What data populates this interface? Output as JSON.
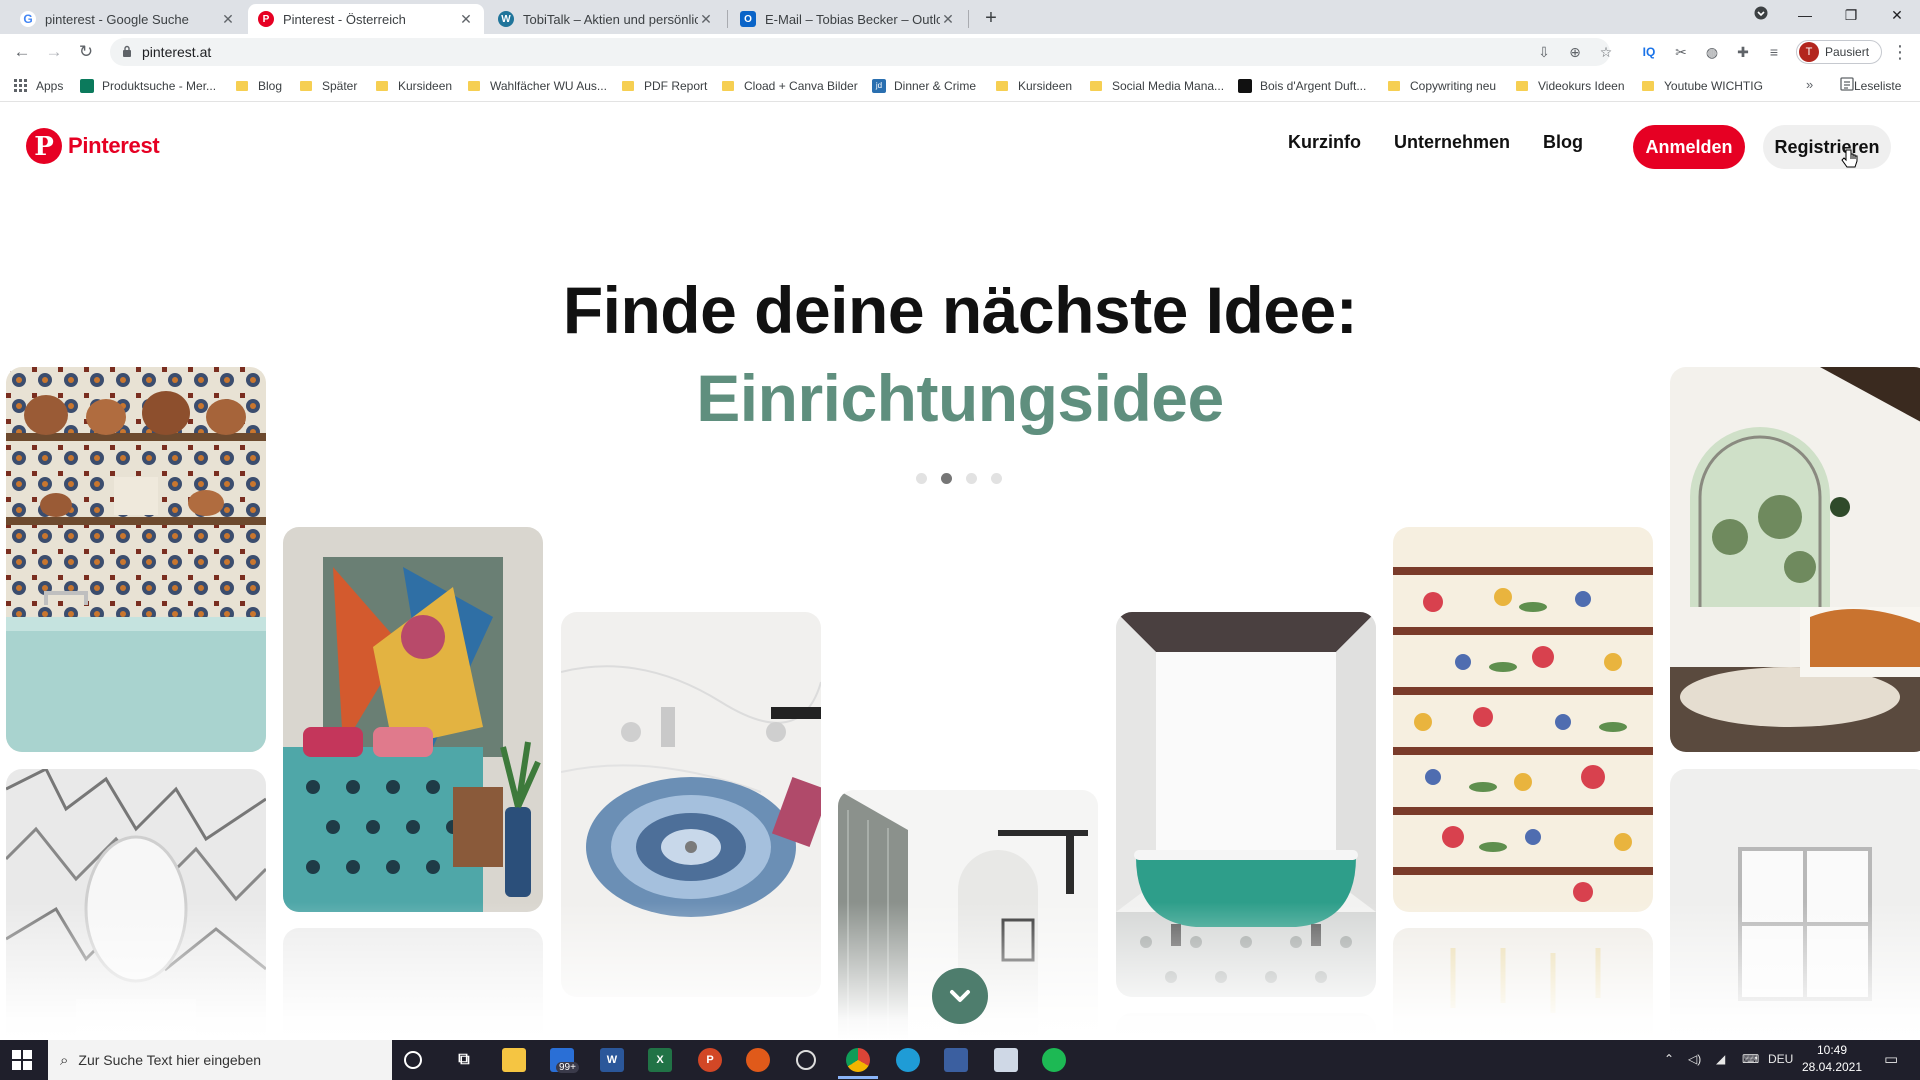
{
  "browser": {
    "tabs": [
      {
        "label": "pinterest - Google Suche",
        "icon": "google-favicon"
      },
      {
        "label": "Pinterest - Österreich",
        "icon": "pinterest-favicon",
        "active": true
      },
      {
        "label": "TobiTalk – Aktien und persönliche",
        "icon": "wordpress-favicon"
      },
      {
        "label": "E-Mail – Tobias Becker – Outlook",
        "icon": "outlook-favicon"
      }
    ],
    "url": "pinterest.at",
    "profile_initial": "T",
    "profile_status": "Pausiert",
    "bookmarks": [
      {
        "label": "Apps",
        "icon": "apps-grid-icon"
      },
      {
        "label": "Produktsuche - Mer...",
        "icon": "produktsuche-icon"
      },
      {
        "label": "Blog",
        "icon": "folder-icon"
      },
      {
        "label": "Später",
        "icon": "folder-icon"
      },
      {
        "label": "Kursideen",
        "icon": "folder-icon"
      },
      {
        "label": "Wahlfächer WU Aus...",
        "icon": "folder-icon"
      },
      {
        "label": "PDF Report",
        "icon": "folder-icon"
      },
      {
        "label": "Cload + Canva Bilder",
        "icon": "folder-icon"
      },
      {
        "label": "Dinner & Crime",
        "icon": "jd-icon"
      },
      {
        "label": "Kursideen",
        "icon": "folder-icon"
      },
      {
        "label": "Social Media Mana...",
        "icon": "folder-icon"
      },
      {
        "label": "Bois d'Argent Duft...",
        "icon": "bois-icon"
      },
      {
        "label": "Copywriting neu",
        "icon": "folder-icon"
      },
      {
        "label": "Videokurs Ideen",
        "icon": "folder-icon"
      },
      {
        "label": "Youtube WICHTIG",
        "icon": "folder-icon"
      }
    ],
    "bookmarks_more": "»",
    "reading_list": "Leseliste"
  },
  "site": {
    "logo_text": "Pinterest",
    "logo_letter": "P",
    "nav": [
      "Kurzinfo",
      "Unternehmen",
      "Blog"
    ],
    "login_label": "Anmelden",
    "signup_label": "Registrieren",
    "headline": "Finde deine nächste Idee:",
    "subheadline": "Einrichtungsidee",
    "carousel_active_index": 2,
    "carousel_count": 4,
    "colors": {
      "brand": "#e60023",
      "accent": "#5f8f7e",
      "scroll_button": "#4e7d6d"
    }
  },
  "taskbar": {
    "search_placeholder": "Zur Suche Text hier eingeben",
    "mail_badge": "99+",
    "language": "DEU",
    "time": "10:49",
    "date": "28.04.2021"
  }
}
